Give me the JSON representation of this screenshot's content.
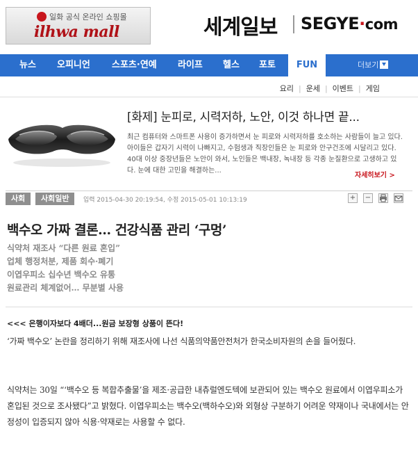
{
  "mall": {
    "subtitle": "일화 공식 온라인 쇼핑몰",
    "name": "ilhwa mall"
  },
  "brand": {
    "korean": "세계일보",
    "english_main": "SEGYE",
    "english_dot": "·",
    "english_com": "com"
  },
  "nav": {
    "items": [
      {
        "label": "뉴스"
      },
      {
        "label": "오피니언"
      },
      {
        "label": "스포츠·연예"
      },
      {
        "label": "라이프"
      },
      {
        "label": "헬스"
      },
      {
        "label": "포토"
      },
      {
        "label": "FUN"
      }
    ],
    "more_label": "더보기"
  },
  "subnav": {
    "items": [
      "요리",
      "운세",
      "이벤트",
      "게임"
    ]
  },
  "promo": {
    "title": "[화제] 눈피로, 시력저하, 노안, 이것 하나면 끝...",
    "description": "최근 컴퓨터와 스마트폰 사용이 증가하면서 눈 피로와 시력저하를 호소하는 사람들이 늘고 있다. 아이들은 갑자기 시력이 나빠지고, 수험생과 직장인들은 눈 피로와 안구건조에 시달리고 있다. 40대 이상 중장년들은 노안이 와서, 노인들은 백내장, 녹내장 등 각종 눈질환으로 고생하고 있다. 눈에 대한 고민을 해결하는...",
    "more_label": "자세히보기 >"
  },
  "meta": {
    "category": "사회",
    "subcategory": "사회일반",
    "dates": "입력 2015-04-30 20:19:54, 수정 2015-05-01 10:13:19",
    "tools": [
      "+",
      "−",
      "print-icon",
      "mail-icon"
    ]
  },
  "article": {
    "headline": "백수오 가짜 결론… 건강식품 관리 ‘구멍’",
    "subheads": [
      "식약처 재조사 “다른 원료 혼입”",
      "업체 행정처분, 제품 회수·폐기",
      "이엽우피소 십수년 백수오 유통",
      "원료관리 체계없어… 무분별 사용"
    ],
    "ad_link": "<<< 은행이자보다 4배더...원금 보장형 상품이 뜬다!",
    "paragraphs": [
      "‘가짜 백수오’ 논란을 정리하기 위해 재조사에 나선 식품의약품안전처가 한국소비자원의 손을 들어줬다.",
      "식약처는 30일 “‘백수오 등 복합추출물’을 제조·공급한 내츄럴엔도텍에 보관되어 있는 백수오 원료에서 이엽우피소가 혼입된 것으로 조사됐다”고 밝혔다. 이엽우피소는 백수오(백하수오)와 외형상 구분하기 어려운 약재이나 국내에서는 안정성이 입증되지 않아 식용·약재로는 사용할 수 없다."
    ]
  },
  "colors": {
    "nav_blue": "#2b6fcd",
    "accent_red": "#c8161d"
  }
}
